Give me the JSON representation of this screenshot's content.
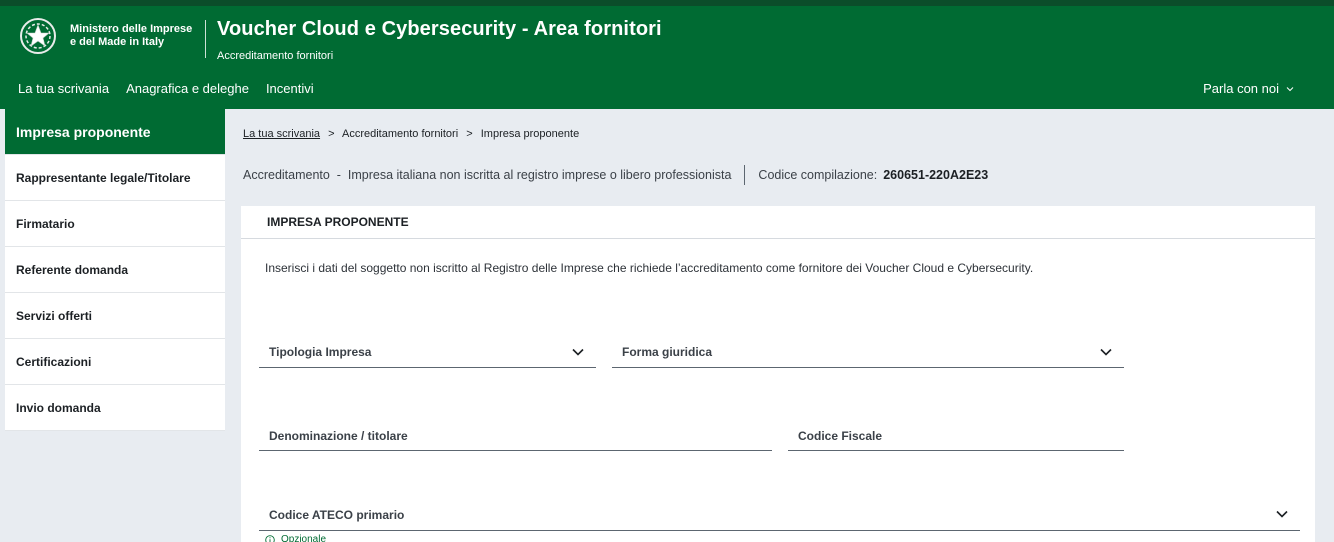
{
  "header": {
    "ministry_line1": "Ministero delle Imprese",
    "ministry_line2": "e del Made in Italy",
    "title": "Voucher Cloud e Cybersecurity - Area fornitori",
    "subtitle": "Accreditamento fornitori",
    "nav": [
      "La tua scrivania",
      "Anagrafica e deleghe",
      "Incentivi"
    ],
    "chat_label": "Parla con noi"
  },
  "sidebar": {
    "items": [
      {
        "label": "Impresa proponente",
        "active": true
      },
      {
        "label": "Rappresentante legale/Titolare"
      },
      {
        "label": "Firmatario"
      },
      {
        "label": "Referente domanda"
      },
      {
        "label": "Servizi offerti"
      },
      {
        "label": "Certificazioni"
      },
      {
        "label": "Invio domanda"
      }
    ]
  },
  "breadcrumb": {
    "home": "La tua scrivania",
    "level2": "Accreditamento fornitori",
    "current": "Impresa proponente",
    "separator": ">"
  },
  "info": {
    "accreditamento": "Accreditamento  -  Impresa italiana non iscritta al registro imprese o libero professionista",
    "code_label": "Codice compilazione:",
    "code_value": "260651-220A2E23"
  },
  "panel": {
    "title": "IMPRESA PROPONENTE",
    "intro": "Inserisci i dati del soggetto non iscritto al Registro delle Imprese che richiede l’accreditamento come fornitore dei Voucher Cloud e Cybersecurity.",
    "fields": {
      "tipologia": "Tipologia Impresa",
      "forma": "Forma giuridica",
      "denominazione": "Denominazione / titolare",
      "codice_fiscale": "Codice Fiscale",
      "ateco": "Codice ATECO primario"
    },
    "hint": "Opzionale"
  },
  "colors": {
    "brand_green": "#006b33",
    "page_bg": "#e8ecf1"
  }
}
